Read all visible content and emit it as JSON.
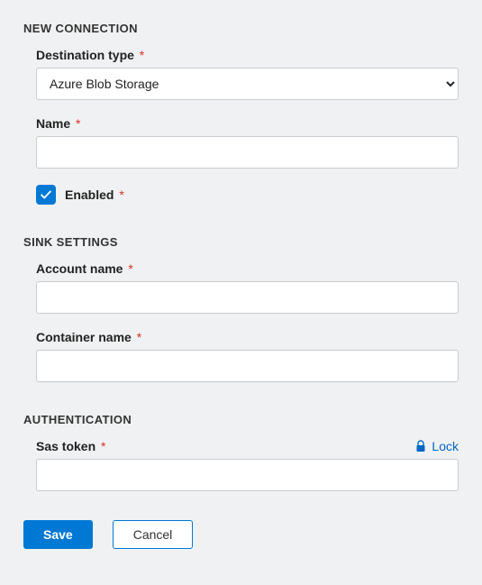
{
  "sections": {
    "new_connection": {
      "title": "NEW CONNECTION",
      "destination_type": {
        "label": "Destination type",
        "value": "Azure Blob Storage"
      },
      "name": {
        "label": "Name",
        "value": ""
      },
      "enabled": {
        "label": "Enabled",
        "checked": true
      }
    },
    "sink_settings": {
      "title": "SINK SETTINGS",
      "account_name": {
        "label": "Account name",
        "value": ""
      },
      "container_name": {
        "label": "Container name",
        "value": ""
      }
    },
    "authentication": {
      "title": "AUTHENTICATION",
      "sas_token": {
        "label": "Sas token",
        "value": ""
      },
      "lock_label": "Lock"
    }
  },
  "buttons": {
    "save": "Save",
    "cancel": "Cancel"
  },
  "colors": {
    "primary": "#0078d4",
    "required": "#d93025"
  }
}
